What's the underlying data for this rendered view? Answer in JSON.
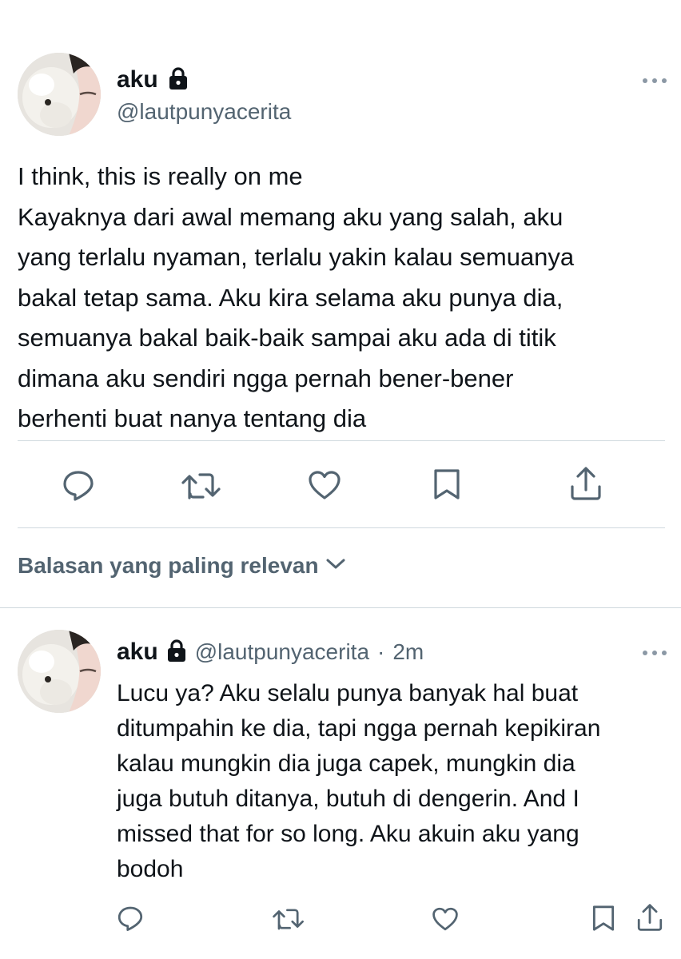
{
  "tweet": {
    "display_name": "aku",
    "handle": "@lautpunyacerita",
    "text_lines": [
      "I think, this is really on me",
      "Kayaknya dari awal memang aku yang salah, aku",
      "yang terlalu nyaman, terlalu yakin kalau semuanya",
      "bakal tetap sama. Aku kira selama aku punya dia,",
      "semuanya bakal baik-baik sampai aku ada di titik",
      "dimana aku sendiri ngga pernah bener-bener",
      "berhenti buat nanya tentang dia"
    ]
  },
  "replies_sort": {
    "label": "Balasan yang paling relevan"
  },
  "reply": {
    "display_name": "aku",
    "handle": "@lautpunyacerita",
    "separator": "·",
    "time": "2m",
    "text_lines": [
      "Lucu ya? Aku selalu punya banyak hal buat",
      "ditumpahin ke dia, tapi ngga pernah kepikiran",
      "kalau mungkin dia juga capek, mungkin dia",
      "juga butuh ditanya, butuh di dengerin. And I",
      "missed that for so long. Aku akuin aku yang",
      "bodoh"
    ]
  },
  "icons": {
    "lock": "lock-icon",
    "more": "more-icon",
    "reply": "reply-icon",
    "retweet": "retweet-icon",
    "like": "like-icon",
    "bookmark": "bookmark-icon",
    "share": "share-icon",
    "chevron": "chevron-down-icon"
  },
  "colors": {
    "text": "#0f1419",
    "secondary": "#536471",
    "divider": "#cfd9de"
  }
}
